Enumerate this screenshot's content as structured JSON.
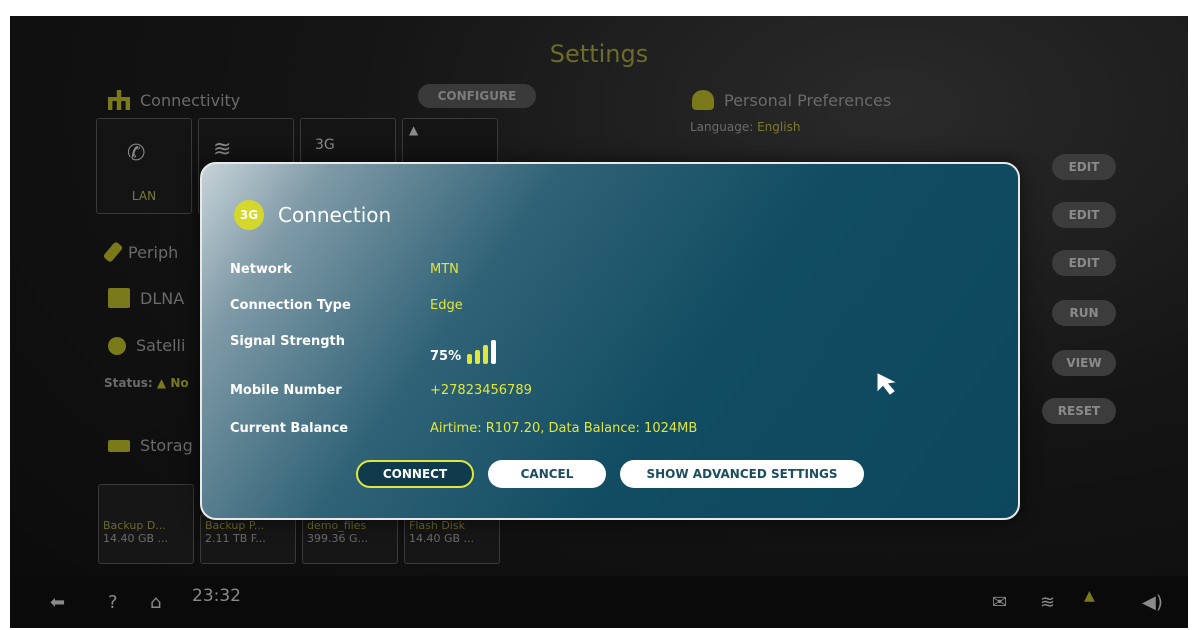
{
  "background": {
    "title": "Settings",
    "connectivity": {
      "label": "Connectivity",
      "configure_label": "CONFIGURE"
    },
    "tiles": [
      {
        "label": "LAN"
      }
    ],
    "personal": {
      "label": "Personal Preferences",
      "language_key": "Language:",
      "language_value": "English"
    },
    "peripherals_label": "Periph",
    "dlna_label": "DLNA",
    "satellite_label": "Satelli",
    "status_key": "Status:",
    "status_value": "No",
    "storage_label": "Storag",
    "side_buttons": [
      "EDIT",
      "EDIT",
      "EDIT",
      "RUN",
      "VIEW",
      "RESET"
    ],
    "storage_items": [
      {
        "name": "Backup D...",
        "size": "14.40 GB ..."
      },
      {
        "name": "Backup P...",
        "size": "2.11 TB F..."
      },
      {
        "name": "demo_files",
        "size": "399.36 G..."
      },
      {
        "name": "Flash Disk",
        "size": "14.40 GB ..."
      }
    ],
    "clock": "23:32",
    "accent": "#e3e63a"
  },
  "modal": {
    "badge": "3G",
    "title": "Connection",
    "rows": {
      "network": {
        "key": "Network",
        "value": "MTN"
      },
      "type": {
        "key": "Connection Type",
        "value": "Edge"
      },
      "signal": {
        "key": "Signal Strength",
        "value": "75%",
        "level": 0.75
      },
      "mobile": {
        "key": "Mobile Number",
        "value": "+27823456789"
      },
      "balance": {
        "key": "Current Balance",
        "value": "Airtime: R107.20, Data Balance: 1024MB"
      }
    },
    "buttons": {
      "connect": "CONNECT",
      "cancel": "CANCEL",
      "advanced": "SHOW ADVANCED SETTINGS"
    }
  }
}
